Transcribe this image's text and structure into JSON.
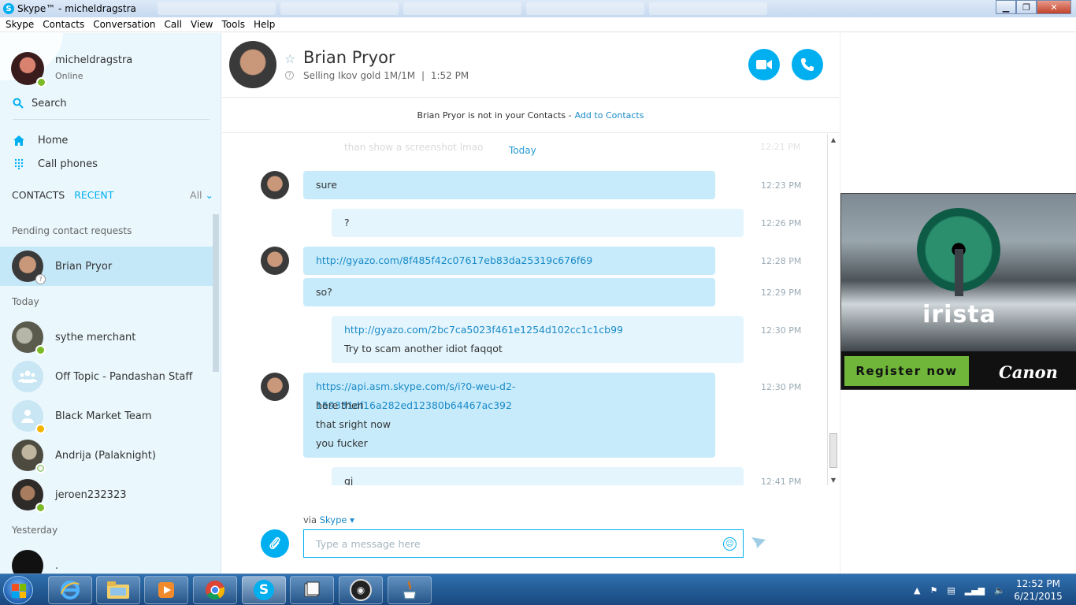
{
  "window": {
    "title": "Skype™ - micheldragstra"
  },
  "menu": [
    "Skype",
    "Contacts",
    "Conversation",
    "Call",
    "View",
    "Tools",
    "Help"
  ],
  "me": {
    "name": "micheldragstra",
    "status": "Online"
  },
  "search": {
    "label": "Search"
  },
  "nav": {
    "home": "Home",
    "call_phones": "Call phones"
  },
  "tabs": {
    "contacts": "CONTACTS",
    "recent": "RECENT",
    "filter": "All"
  },
  "sections": {
    "pending": "Pending contact requests",
    "today": "Today",
    "yesterday": "Yesterday"
  },
  "contacts": [
    {
      "name": "Brian Pryor"
    },
    {
      "name": "sythe merchant"
    },
    {
      "name": "Off Topic - Pandashan Staff"
    },
    {
      "name": "Black Market Team"
    },
    {
      "name": "Andrija (Palaknight)"
    },
    {
      "name": "jeroen232323"
    },
    {
      "name": "."
    }
  ],
  "conversation": {
    "name": "Brian Pryor",
    "mood": "Selling Ikov gold 1M/1M",
    "local_time": "1:52 PM",
    "separator": "|",
    "notice": "Brian Pryor is not in your Contacts -",
    "add_link": "Add to Contacts",
    "faded_text": "than show a screenshot lmao",
    "day": "Today"
  },
  "messages": [
    {
      "time": "12:23 PM",
      "lines": [
        "sure"
      ]
    },
    {
      "time": "12:26 PM",
      "lines": [
        "?"
      ]
    },
    {
      "time": "12:28 PM",
      "lines": [
        "http://gyazo.com/8f485f42c07617eb83da25319c676f69"
      ]
    },
    {
      "time": "12:29 PM",
      "lines": [
        "so?"
      ]
    },
    {
      "time": "12:30 PM",
      "lines": [
        "http://gyazo.com/2bc7ca5023f461e1254d102cc1c1cb99",
        "Try to scam another idiot faqqot"
      ]
    },
    {
      "time": "12:30 PM",
      "lines": [
        "https://api.asm.skype.com/s/i?0-weu-d2-159331df16a282ed12380b64467ac392",
        "here then",
        "that sright now",
        "you fucker"
      ]
    },
    {
      "time": "12:41 PM",
      "lines": [
        "gj"
      ]
    }
  ],
  "composer": {
    "via": "via",
    "via_service": "Skype",
    "placeholder": "Type a message here"
  },
  "ad": {
    "brand": "irista",
    "cta": "Register now",
    "sponsor": "Canon"
  },
  "taskbar": {
    "time": "12:52 PM",
    "date": "6/21/2015"
  },
  "icons": {
    "search": "search-icon",
    "home": "home-icon",
    "dialpad": "dialpad-icon",
    "video": "video-call-icon",
    "call": "phone-icon",
    "attach": "paperclip-icon",
    "emoji": "emoticon-icon",
    "send": "send-icon",
    "star": "star-icon"
  },
  "colors": {
    "accent": "#00aff0",
    "sidebar_bg": "#eaf7fd",
    "bubble_in": "#c7ebfb",
    "bubble_out": "#e4f5fd",
    "online": "#7dba28",
    "away": "#f5b400"
  }
}
